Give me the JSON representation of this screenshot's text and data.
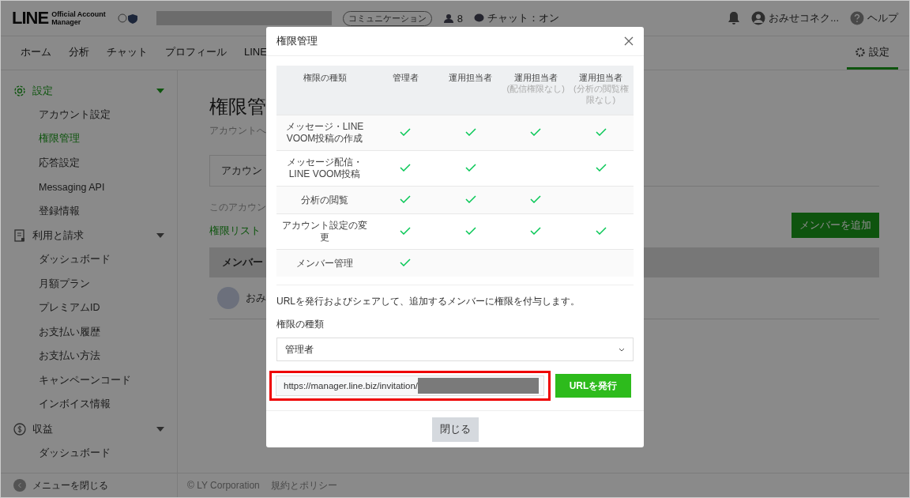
{
  "header": {
    "logo_main": "LINE",
    "logo_sub": [
      "Official Account",
      "Manager"
    ],
    "category_badge": "コミュニケーション",
    "friend_count": "8",
    "chat_status": "チャット：オン",
    "account_name": "おみせコネク...",
    "help": "ヘルプ"
  },
  "nav": {
    "tabs": [
      {
        "label": "ホーム",
        "selected": false
      },
      {
        "label": "分析",
        "selected": false
      },
      {
        "label": "チャット",
        "selected": false
      },
      {
        "label": "プロフィール",
        "selected": false
      },
      {
        "label": "LINE",
        "selected": false
      }
    ],
    "settings_tab": {
      "label": "設定",
      "selected": true
    }
  },
  "sidebar": {
    "sections": [
      {
        "label": "設定",
        "kind": "gear",
        "active": true,
        "expanded": true,
        "children": [
          {
            "label": "アカウント設定",
            "selected": false
          },
          {
            "label": "権限管理",
            "selected": true
          },
          {
            "label": "応答設定",
            "selected": false
          },
          {
            "label": "Messaging API",
            "selected": false
          },
          {
            "label": "登録情報",
            "selected": false
          }
        ]
      },
      {
        "label": "利用と請求",
        "kind": "receipt",
        "active": false,
        "expanded": true,
        "children": [
          {
            "label": "ダッシュボード",
            "selected": false
          },
          {
            "label": "月額プラン",
            "selected": false
          },
          {
            "label": "プレミアムID",
            "selected": false
          },
          {
            "label": "お支払い履歴",
            "selected": false
          },
          {
            "label": "お支払い方法",
            "selected": false
          },
          {
            "label": "キャンペーンコード",
            "selected": false
          },
          {
            "label": "インボイス情報",
            "selected": false
          }
        ]
      },
      {
        "label": "収益",
        "kind": "dollar",
        "active": false,
        "expanded": true,
        "children": [
          {
            "label": "ダッシュボード",
            "selected": false
          }
        ]
      }
    ],
    "close_menu": "メニューを閉じる"
  },
  "main": {
    "title": "権限管",
    "subtitle": "アカウントへ",
    "tab": "アカウン",
    "description": "このアカウン",
    "list_link": "権限リスト",
    "add_button": "メンバーを追加",
    "table_header": "メンバー",
    "member_name": "おみ"
  },
  "footer": {
    "copyright": "© LY Corporation",
    "policy_link": "規約とポリシー"
  },
  "modal": {
    "title": "権限管理",
    "columns": [
      {
        "label": "権限の種類"
      },
      {
        "label": "管理者"
      },
      {
        "label": "運用担当者"
      },
      {
        "label": "運用担当者",
        "note": "(配信権限なし)"
      },
      {
        "label": "運用担当者",
        "note": "(分析の閲覧権限なし)"
      }
    ],
    "rows": [
      {
        "label": "メッセージ・LINE VOOM投稿の作成",
        "checks": [
          true,
          true,
          true,
          true
        ]
      },
      {
        "label": "メッセージ配信・LINE VOOM投稿",
        "checks": [
          true,
          true,
          false,
          true
        ]
      },
      {
        "label": "分析の閲覧",
        "checks": [
          true,
          true,
          true,
          false
        ]
      },
      {
        "label": "アカウント設定の変更",
        "checks": [
          true,
          true,
          true,
          true
        ]
      },
      {
        "label": "メンバー管理",
        "checks": [
          true,
          false,
          false,
          false
        ]
      }
    ],
    "instruction": "URLを発行およびシェアして、追加するメンバーに権限を付与します。",
    "field_label": "権限の種類",
    "role_select": "管理者",
    "invitation_url": "https://manager.line.biz/invitation/",
    "issue_button": "URLを発行",
    "close_button": "閉じる"
  }
}
